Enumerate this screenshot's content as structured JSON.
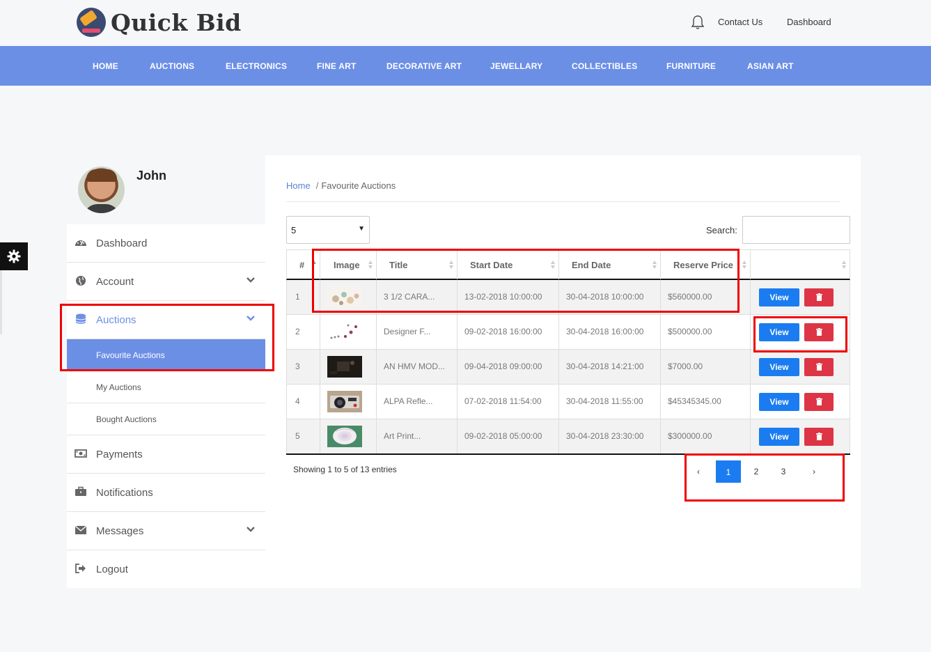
{
  "brand": {
    "name": "Quick Bid"
  },
  "header": {
    "links": [
      "Contact Us",
      "Dashboard"
    ]
  },
  "nav": [
    "HOME",
    "AUCTIONS",
    "ELECTRONICS",
    "FINE ART",
    "DECORATIVE ART",
    "JEWELLARY",
    "COLLECTIBLES",
    "FURNITURE",
    "ASIAN ART"
  ],
  "profile": {
    "name": "John"
  },
  "sidebar": {
    "dashboard": "Dashboard",
    "account": "Account",
    "auctions": "Auctions",
    "favourite": "Favourite Auctions",
    "my": "My Auctions",
    "bought": "Bought Auctions",
    "payments": "Payments",
    "notifications": "Notifications",
    "messages": "Messages",
    "logout": "Logout"
  },
  "breadcrumb": {
    "home": "Home",
    "sep": "/",
    "current": "Favourite Auctions"
  },
  "controls": {
    "page_size": "5",
    "search_label": "Search:",
    "search_value": ""
  },
  "table": {
    "headers": [
      "#",
      "Image",
      "Title",
      "Start Date",
      "End Date",
      "Reserve Price"
    ],
    "view_label": "View",
    "rows": [
      {
        "num": "1",
        "image": "jewelry-thumbnail",
        "title": "3 1/2 CARA...",
        "start": "13-02-2018 10:00:00",
        "end": "30-04-2018 10:00:00",
        "price": "$560000.00"
      },
      {
        "num": "2",
        "image": "earrings-thumbnail",
        "title": "Designer F...",
        "start": "09-02-2018 16:00:00",
        "end": "30-04-2018 16:00:00",
        "price": "$500000.00"
      },
      {
        "num": "3",
        "image": "dark-photo-thumbnail",
        "title": "AN HMV MOD...",
        "start": "09-04-2018 09:00:00",
        "end": "30-04-2018 14:21:00",
        "price": "$7000.00"
      },
      {
        "num": "4",
        "image": "camera-thumbnail",
        "title": "ALPA Refle...",
        "start": "07-02-2018 11:54:00",
        "end": "30-04-2018 11:55:00",
        "price": "$45345345.00"
      },
      {
        "num": "5",
        "image": "rose-thumbnail",
        "title": "Art Print...",
        "start": "09-02-2018 05:00:00",
        "end": "30-04-2018 23:30:00",
        "price": "$300000.00"
      }
    ]
  },
  "footer": {
    "info": "Showing 1 to 5 of 13 entries",
    "pages": [
      "‹",
      "1",
      "2",
      "3",
      "›"
    ],
    "active_page": "1"
  },
  "colors": {
    "nav": "#6c8fe6",
    "view": "#1a7cf0",
    "delete": "#dd3545",
    "annotation": "#e00000"
  }
}
